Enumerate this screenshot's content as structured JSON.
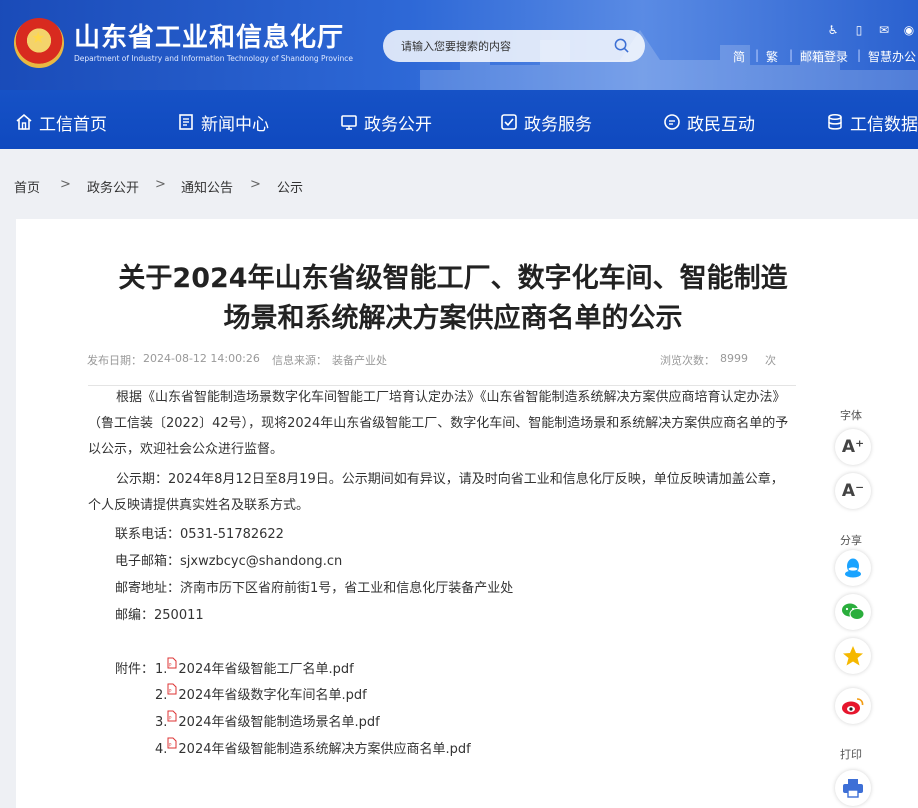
{
  "header": {
    "site_title": "山东省工业和信息化厅",
    "site_subtitle": "Department of Industry and Information Technology of Shandong Province",
    "search_placeholder": "请输入您要搜索的内容",
    "top_icons": [
      "accessibility-icon",
      "mobile-icon",
      "wechat-icon",
      "weibo-icon"
    ],
    "links": {
      "simplified": "简",
      "sep1": "|",
      "traditional": "繁",
      "sep2": "|",
      "mail_login": "邮箱登录",
      "sep3": "|",
      "smart_office": "智慧办公"
    }
  },
  "nav": {
    "items": [
      {
        "label": "工信首页",
        "icon": "home-icon"
      },
      {
        "label": "新闻中心",
        "icon": "news-icon"
      },
      {
        "label": "政务公开",
        "icon": "monitor-icon"
      },
      {
        "label": "政务服务",
        "icon": "service-icon"
      },
      {
        "label": "政民互动",
        "icon": "chat-icon"
      },
      {
        "label": "工信数据",
        "icon": "database-icon"
      }
    ]
  },
  "breadcrumb": {
    "items": [
      "首页",
      "政务公开",
      "通知公告",
      "公示"
    ],
    "separator": ">"
  },
  "article": {
    "title_line1": "关于2024年山东省级智能工厂、数字化车间、智能制造",
    "title_line2": "场景和系统解决方案供应商名单的公示",
    "publish_label": "发布日期：",
    "publish_date": "2024-08-12 14:00:26",
    "source_label": "信息来源：",
    "source": "装备产业处",
    "views_label": "浏览次数：",
    "views": "8999",
    "views_unit": "次",
    "para1": "根据《山东省智能制造场景数字化车间智能工厂培育认定办法》《山东省智能制造系统解决方案供应商培育认定办法》（鲁工信装〔2022〕42号），现将2024年山东省级智能工厂、数字化车间、智能制造场景和系统解决方案供应商名单的予以公示，欢迎社会公众进行监督。",
    "para2": "公示期：2024年8月12日至8月19日。公示期间如有异议，请及时向省工业和信息化厅反映，单位反映请加盖公章，个人反映请提供真实姓名及联系方式。",
    "phone": "联系电话：0531-51782622",
    "email": "电子邮箱：sjxwzbcyc@shandong.cn",
    "address": "邮寄地址：济南市历下区省府前街1号，省工业和信息化厅装备产业处",
    "postcode": "邮编：250011",
    "attachments_label": "附件：",
    "attachments": [
      {
        "num": "1.",
        "name": "2024年省级智能工厂名单.pdf"
      },
      {
        "num": "2.",
        "name": "2024年省级数字化车间名单.pdf"
      },
      {
        "num": "3.",
        "name": "2024年省级智能制造场景名单.pdf"
      },
      {
        "num": "4.",
        "name": "2024年省级智能制造系统解决方案供应商名单.pdf"
      }
    ]
  },
  "side_tools": {
    "font_label": "字体",
    "font_increase": "A⁺",
    "font_decrease": "A⁻",
    "share_label": "分享",
    "share_icons": [
      "qq-icon",
      "wechat-share-icon",
      "qzone-icon",
      "weibo-share-icon"
    ],
    "print_label": "打印",
    "print_icon": "printer-icon"
  },
  "colors": {
    "header_blue": "#1753c7",
    "page_bg": "#eef0f4",
    "qq_blue": "#1aa3ff",
    "wechat_green": "#2aae3c",
    "qzone_yellow": "#f5b800",
    "weibo_red": "#e6162d"
  }
}
